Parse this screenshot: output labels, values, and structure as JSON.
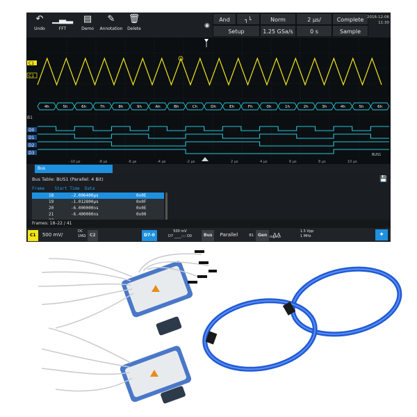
{
  "toolbar": {
    "buttons": [
      {
        "label": "Undo",
        "icon": "undo-arrow-icon"
      },
      {
        "label": "FFT",
        "icon": "fft-icon"
      },
      {
        "label": "Demo",
        "icon": "demo-icon"
      },
      {
        "label": "Annotation",
        "icon": "pencil-icon"
      },
      {
        "label": "Delete",
        "icon": "trash-icon"
      }
    ],
    "trigger": {
      "source": "And",
      "mode": "Norm",
      "timebase": "2 µs/",
      "acquisition": "Complete"
    },
    "setup": {
      "label": "Setup",
      "sample_rate": "1.25 GSa/s",
      "position": "0 s",
      "mode": "Sample"
    },
    "datetime": {
      "date": "2016-12-06",
      "time": "11:30"
    }
  },
  "channels": {
    "c1": "C1",
    "b1": "B1",
    "d0": "D0",
    "d1": "D1",
    "d2": "D2",
    "d3": "D3"
  },
  "bus_labels": [
    "4h",
    "5h",
    "6h",
    "7h",
    "8h",
    "9h",
    "Ah",
    "Bh",
    "Ch",
    "Dh",
    "Eh",
    "Fh",
    "0h",
    "1h",
    "2h",
    "3h",
    "4h",
    "5h",
    "6h"
  ],
  "time_axis": [
    "-10 µs",
    "-8 µs",
    "-6 µs",
    "-4 µs",
    "-2 µs",
    "2 µs",
    "4 µs",
    "6 µs",
    "8 µs",
    "10 µs"
  ],
  "bus_right_label": "BUS1",
  "bus_panel": {
    "tab_label": "Bus",
    "table_title": "Bus Table: BUS1 (Parallel: 4 Bit)",
    "headers": {
      "frame": "Frame",
      "start_time": "Start Time",
      "data": "Data"
    },
    "rows": [
      {
        "frame": "18",
        "start": "-2.006400µs",
        "data": "0x0E",
        "selected": true
      },
      {
        "frame": "19",
        "start": "-1.012800µs",
        "data": "0x0F",
        "selected": false
      },
      {
        "frame": "20",
        "start": "-6.000000ns",
        "data": "0x0E",
        "selected": false
      },
      {
        "frame": "21",
        "start": "-6.400000ns",
        "data": "0x00",
        "selected": false
      },
      {
        "frame": "22",
        "start": "987.200000ns",
        "data": "0x01",
        "selected": false
      }
    ],
    "frames_text": "Frames: 18–22 / 41"
  },
  "status_bar": {
    "c1_badge": "C1",
    "c1_value": "500 mV/",
    "c1_coupling": "DC",
    "c1_impedance": "1MΩ",
    "c2_badge": "C2",
    "d70_badge": "D7-0",
    "d70_value": "500 mV",
    "d70_sub": "D7 ____:::: D0",
    "bus_badge": "Bus",
    "bus_value": "Parallel",
    "bus_id": "B1",
    "gen_badge": "Gen",
    "gen_wave": "High-Z",
    "gen_amp": "1.5 Vpp",
    "gen_freq": "1 MHz"
  },
  "colors": {
    "c1_yellow": "#f2e51a",
    "digital_cyan": "#27c4d6",
    "accent_blue": "#1e90e0",
    "background": "#0b0f12",
    "cable_blue": "#1f5bd6"
  }
}
